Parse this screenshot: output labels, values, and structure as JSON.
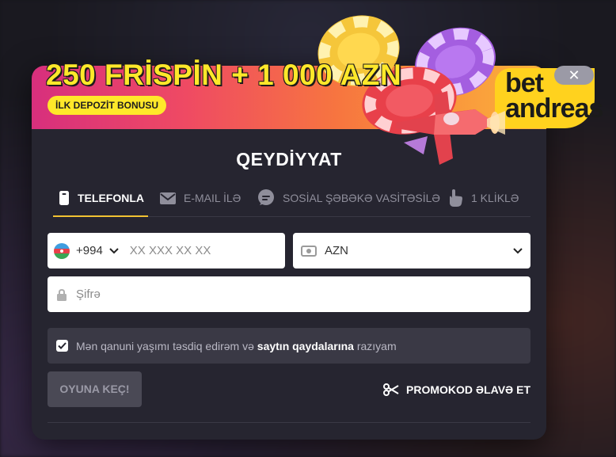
{
  "banner": {
    "headline": "250 FRİSPİN + 1 000 AZN",
    "badge": "İLK DEPOZİT BONUSU",
    "logo_line1": "bet",
    "logo_line2": "andreas",
    "close_label": "✕"
  },
  "form": {
    "title": "QEYDİYYAT",
    "tabs": [
      {
        "label": "TELEFONLA",
        "icon": "phone-icon",
        "active": true
      },
      {
        "label": "E-MAIL İLƏ",
        "icon": "envelope-icon",
        "active": false
      },
      {
        "label": "SOSİAL ŞƏBƏKƏ VASİTƏSİLƏ",
        "icon": "chat-icon",
        "active": false
      },
      {
        "label": "1 KLİKLƏ",
        "icon": "hand-pointer-icon",
        "active": false
      }
    ],
    "phone": {
      "country_code": "+994",
      "placeholder": "XX XXX XX XX",
      "flag": "azerbaijan-flag-icon"
    },
    "currency": {
      "value": "AZN",
      "icon": "cash-icon"
    },
    "password": {
      "placeholder": "Şifrə",
      "icon": "lock-icon"
    },
    "terms": {
      "checked": true,
      "text_before": "Mən qanuni yaşımı təsdiq edirəm və",
      "link_text": "saytın qaydalarına",
      "text_after": "razıyam"
    },
    "submit_label": "OYUNA KEÇ!",
    "promo_label": "PROMOKOD ƏLAVƏ ET",
    "promo_icon": "scissors-icon"
  },
  "colors": {
    "accent": "#f2c232",
    "headline": "#ffe82a",
    "modal_bg": "#262530",
    "banner_start": "#d72f7d",
    "banner_end": "#fbb43a"
  }
}
